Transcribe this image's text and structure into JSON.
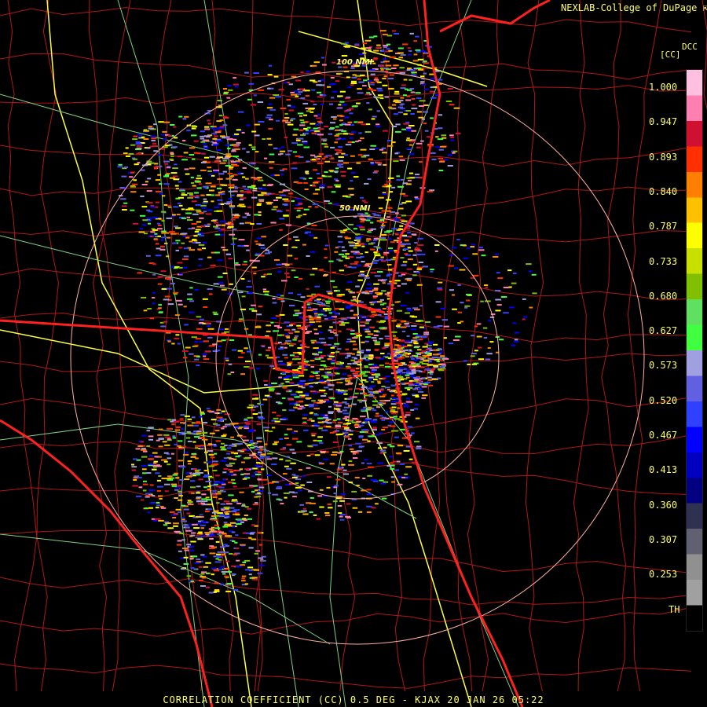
{
  "credit": "NEXLAB-College of DuPage",
  "legend": {
    "code": "DCC",
    "unit": "[CC]",
    "ticks": [
      "1.000",
      "0.947",
      "0.893",
      "0.840",
      "0.787",
      "0.733",
      "0.680",
      "0.627",
      "0.573",
      "0.520",
      "0.467",
      "0.413",
      "0.360",
      "0.307",
      "0.253",
      "TH"
    ],
    "colors": [
      "#ffc0e0",
      "#ff7fb0",
      "#d01030",
      "#ff3000",
      "#ff8000",
      "#ffc000",
      "#ffff00",
      "#c8e000",
      "#80c000",
      "#60e060",
      "#40ff40",
      "#a0a0e0",
      "#6060e0",
      "#3040ff",
      "#0000ff",
      "#0000c0",
      "#000080",
      "#303050",
      "#606070",
      "#909090",
      "#a0a0a0",
      "#000000"
    ]
  },
  "range_rings": {
    "inner": "50 NMI",
    "outer": "100 NMI"
  },
  "footer": "CORRELATION COEFFICIENT (CC) 0.5 DEG - KJAX 20 JAN 26 05:22",
  "colors": {
    "state_border": "#ff2020",
    "coast": "#ff2020",
    "county": "#c01818",
    "highway": "#ffff40",
    "road": "#80d080",
    "ring": "#ffb0a0",
    "text": "#ffff66"
  }
}
